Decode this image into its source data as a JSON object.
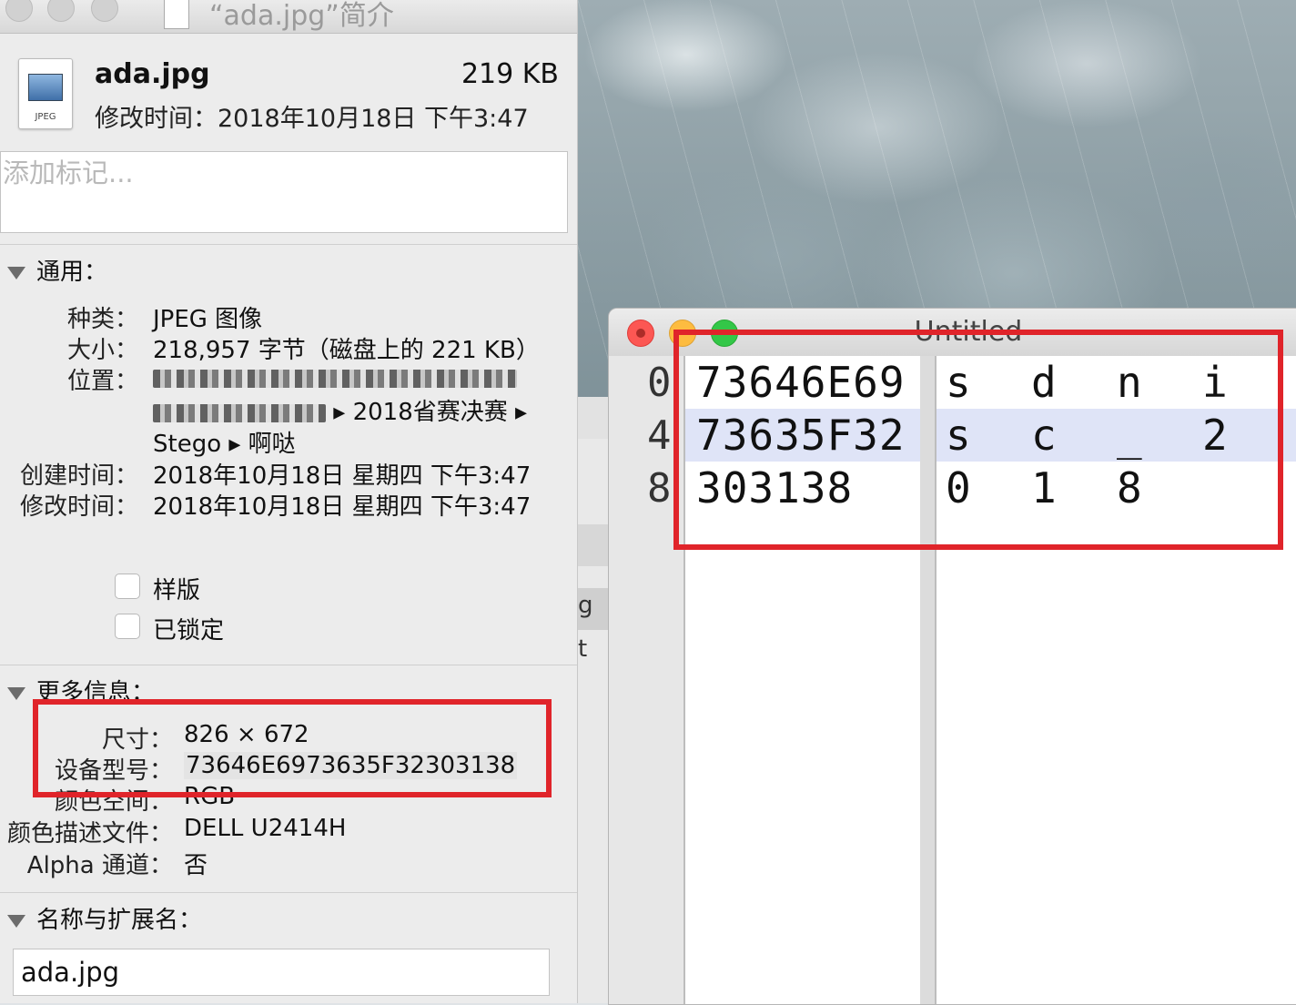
{
  "info_window": {
    "title": "“ada.jpg”简介",
    "file_icon_label": "JPEG",
    "file_name": "ada.jpg",
    "file_size": "219 KB",
    "modified_summary": "修改时间：2018年10月18日 下午3:47",
    "tags_placeholder": "添加标记...",
    "general": {
      "header": "通用：",
      "kind_label": "种类：",
      "kind_value": "JPEG 图像",
      "size_label": "大小：",
      "size_value": "218,957 字节（磁盘上的 221 KB）",
      "where_label": "位置：",
      "where_line2_tail": "▸ 2018省赛决赛 ▸",
      "where_line3": "Stego ▸ 啊哒",
      "created_label": "创建时间：",
      "created_value": "2018年10月18日 星期四 下午3:47",
      "modified_label": "修改时间：",
      "modified_value": "2018年10月18日 星期四 下午3:47",
      "stationery_label": "样版",
      "locked_label": "已锁定"
    },
    "more_info": {
      "header": "更多信息：",
      "dimensions_label": "尺寸：",
      "dimensions_value": "826 × 672",
      "device_model_label": "设备型号：",
      "device_model_value": "73646E6973635F32303138",
      "color_space_label": "颜色空间：",
      "color_space_value": "RGB",
      "color_profile_label": "颜色描述文件：",
      "color_profile_value": "DELL U2414H",
      "alpha_label": "Alpha 通道：",
      "alpha_value": "否"
    },
    "name_ext": {
      "header": "名称与扩展名：",
      "value": "ada.jpg"
    }
  },
  "hex_window": {
    "title": "Untitled",
    "rows": [
      {
        "offset": "0",
        "hex": "73646E69",
        "ascii": [
          "s",
          "d",
          "n",
          "i"
        ],
        "selected": false
      },
      {
        "offset": "4",
        "hex": "73635F32",
        "ascii": [
          "s",
          "c",
          "_",
          "2"
        ],
        "selected": true
      },
      {
        "offset": "8",
        "hex": "303138",
        "ascii": [
          "0",
          "1",
          "8",
          ""
        ],
        "selected": false
      }
    ]
  },
  "background_window": {
    "partial_text_1": "g",
    "partial_text_2": "t"
  },
  "colors": {
    "highlight_box": "#e0242a",
    "selected_row": "#dfe4f7"
  }
}
